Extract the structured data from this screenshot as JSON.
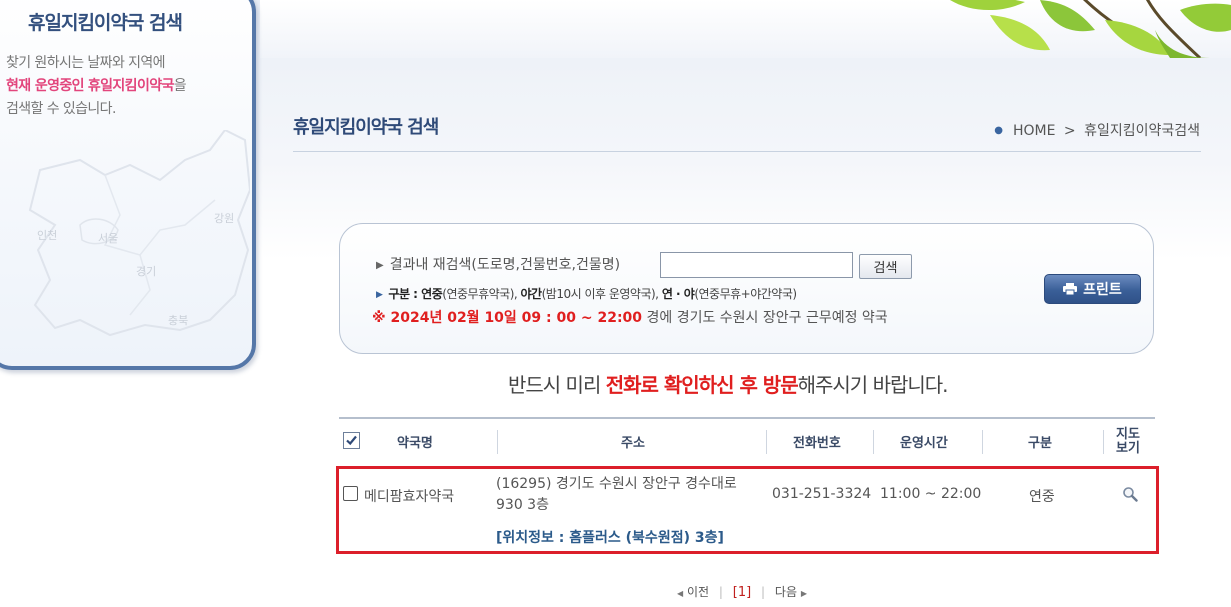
{
  "sidebar": {
    "title": "휴일지킴이약국 검색",
    "desc_line1": "찾기 원하시는 날짜와 지역에",
    "desc_hl1": "현재 운영중인",
    "desc_hl2": "휴일지킴이약국",
    "desc_line2_tail": "을",
    "desc_line3": "검색할 수 있습니다.",
    "map_labels": {
      "incheon": "인천",
      "seoul": "서울",
      "gangwon": "강원",
      "gyeonggi": "경기",
      "chungbuk": "충북"
    }
  },
  "header": {
    "title": "휴일지킴이약국 검색",
    "breadcrumb_home": "HOME",
    "breadcrumb_sep": ">",
    "breadcrumb_current": "휴일지킴이약국검색"
  },
  "search": {
    "label": "결과내 재검색(도로명,건물번호,건물명)",
    "input_value": "",
    "button_label": "검색",
    "legend_prefix": "구분 : ",
    "legend_yeonjung": "연중",
    "legend_yeonjung_desc": "(연중무휴약국), ",
    "legend_yagan": "야간",
    "legend_yagan_desc": "(밤10시 이후 운영약국), ",
    "legend_both": "연 · 야",
    "legend_both_desc": "(연중무휴+야간약국)",
    "date_mark": "※ 2024년 02월 10일 09 : 00 ~ 22:00",
    "date_tail": " 경에  경기도  수원시 장안구   근무예정 약국",
    "print_label": "프린트"
  },
  "notice": {
    "pre": "반드시 미리 ",
    "hl": "전화로 확인하신 후 방문",
    "post": "해주시기 바랍니다."
  },
  "table": {
    "headers": {
      "name": "약국명",
      "address": "주소",
      "phone": "전화번호",
      "hours": "운영시간",
      "type": "구분",
      "map_line1": "지도",
      "map_line2": "보기"
    },
    "rows": [
      {
        "name": "메디팜효자약국",
        "address_line1": "(16295) 경기도 수원시 장안구 경수대로",
        "address_line2": "930 3층",
        "location": "[위치정보 : 홈플러스 (북수원점) 3층]",
        "phone": "031-251-3324",
        "hours": "11:00 ~ 22:00",
        "type": "연중"
      }
    ]
  },
  "pager": {
    "prev": "이전",
    "current": "[1]",
    "next": "다음"
  },
  "colors": {
    "accent_blue": "#2f4a78",
    "highlight_red": "#e01f1f",
    "row_border": "#dc1f2a",
    "sidebar_border": "#5577a8"
  }
}
